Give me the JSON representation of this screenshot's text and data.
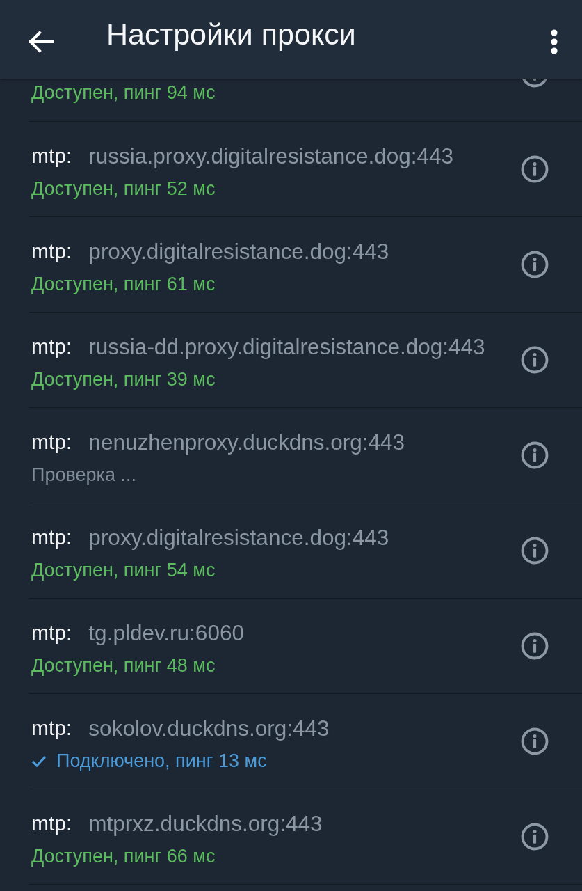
{
  "header": {
    "title": "Настройки прокси"
  },
  "scrolled_row": {
    "status": "Доступен, пинг 94 мс",
    "kind": "available"
  },
  "proxies": [
    {
      "protocol": "mtp:",
      "address": "russia.proxy.digitalresistance.dog:443",
      "status": "Доступен, пинг 52 мс",
      "kind": "available"
    },
    {
      "protocol": "mtp:",
      "address": "proxy.digitalresistance.dog:443",
      "status": "Доступен, пинг 61 мс",
      "kind": "available"
    },
    {
      "protocol": "mtp:",
      "address": "russia-dd.proxy.digitalresistance.dog:443",
      "status": "Доступен, пинг 39 мс",
      "kind": "available"
    },
    {
      "protocol": "mtp:",
      "address": "nenuzhenproxy.duckdns.org:443",
      "status": "Проверка ...",
      "kind": "checking"
    },
    {
      "protocol": "mtp:",
      "address": "proxy.digitalresistance.dog:443",
      "status": "Доступен, пинг 54 мс",
      "kind": "available"
    },
    {
      "protocol": "mtp:",
      "address": "tg.pldev.ru:6060",
      "status": "Доступен, пинг 48 мс",
      "kind": "available"
    },
    {
      "protocol": "mtp:",
      "address": "sokolov.duckdns.org:443",
      "status": "Подключено, пинг 13 мс",
      "kind": "connected"
    },
    {
      "protocol": "mtp:",
      "address": "mtprxz.duckdns.org:443",
      "status": "Доступен, пинг 66 мс",
      "kind": "available"
    }
  ]
}
